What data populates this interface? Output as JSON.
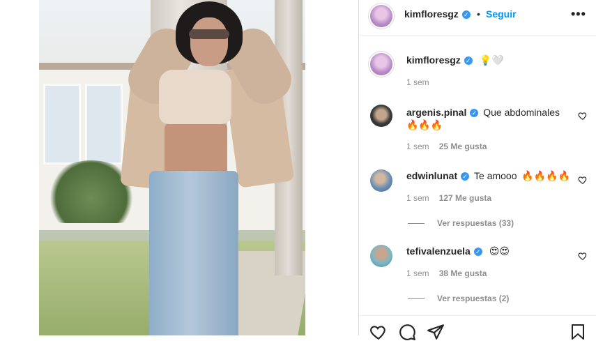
{
  "post": {
    "author": "kimfloresgz",
    "follow_label": "Seguir",
    "separator": "•",
    "more_label": "•••",
    "verified_mark": "✓",
    "caption": "💡🤍",
    "caption_time": "1 sem"
  },
  "comments": [
    {
      "user": "argenis.pinal",
      "text": "Que abdominales",
      "emoji": "🔥🔥🔥",
      "time": "1 sem",
      "likes": "25 Me gusta"
    },
    {
      "user": "edwinlunat",
      "text": "Te amooo",
      "emoji": "🔥🔥🔥🔥",
      "time": "1 sem",
      "likes": "127 Me gusta",
      "replies": "Ver respuestas (33)"
    },
    {
      "user": "tefivalenzuela",
      "text": "",
      "emoji": "😍😍",
      "time": "1 sem",
      "likes": "38 Me gusta",
      "replies": "Ver respuestas (2)"
    }
  ],
  "icons": [
    "heart-icon",
    "comment-icon",
    "share-icon",
    "save-icon",
    "more-icon",
    "verified-icon"
  ],
  "colors": {
    "accent": "#0095f6",
    "verified": "#3897f0",
    "muted": "#8e8e8e",
    "text": "#262626"
  }
}
